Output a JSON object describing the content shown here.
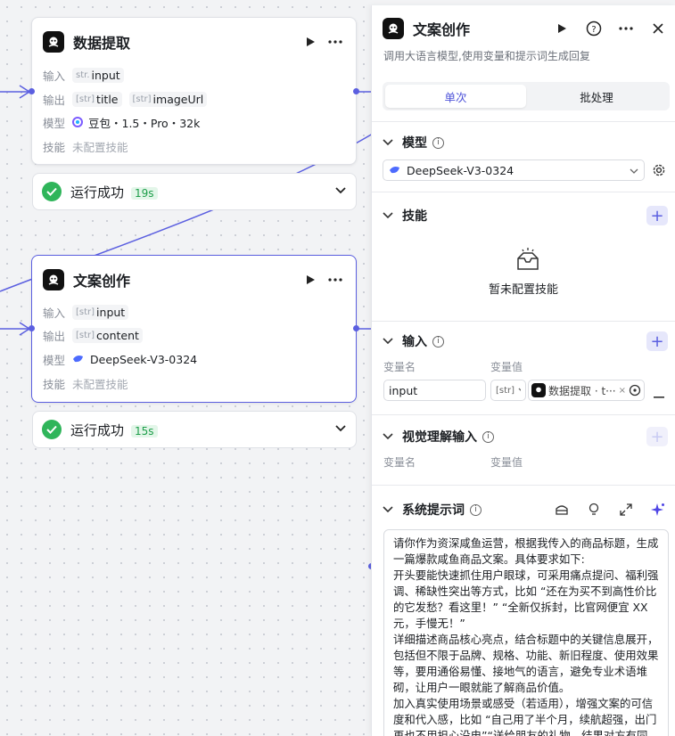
{
  "canvas": {
    "node1": {
      "title": "数据提取",
      "input_label": "输入",
      "input_type": "str.",
      "input_value": "input",
      "output_label": "输出",
      "outputs": [
        {
          "type": "[str]",
          "name": "title"
        },
        {
          "type": "[str]",
          "name": "imageUrl"
        }
      ],
      "model_label": "模型",
      "model_value": "豆包・1.5・Pro・32k",
      "skill_label": "技能",
      "skill_value": "未配置技能"
    },
    "status1": {
      "text": "运行成功",
      "duration": "19s"
    },
    "node2": {
      "title": "文案创作",
      "input_label": "输入",
      "input_type": "[str]",
      "input_value": "input",
      "output_label": "输出",
      "output_type": "[str]",
      "output_value": "content",
      "model_label": "模型",
      "model_value": "DeepSeek-V3-0324",
      "skill_label": "技能",
      "skill_value": "未配置技能"
    },
    "status2": {
      "text": "运行成功",
      "duration": "15s"
    }
  },
  "panel": {
    "title": "文案创作",
    "description": "调用大语言模型,使用变量和提示词生成回复",
    "tabs": [
      "单次",
      "批处理"
    ],
    "model_section": "模型",
    "model_value": "DeepSeek-V3-0324",
    "skill_section": "技能",
    "skill_empty": "暂未配置技能",
    "input_section": "输入",
    "var_name_label": "变量名",
    "var_value_label": "变量值",
    "var_name": "input",
    "var_type": "[str]",
    "var_ref": "数据提取 · t···",
    "vision_section": "视觉理解输入",
    "vision_var_name_label": "变量名",
    "vision_var_value_label": "变量值",
    "prompt_section": "系统提示词",
    "prompt_lines": [
      "请你作为资深咸鱼运营，根据我传入的商品标题，生成一篇爆款咸鱼商品文案。具体要求如下:",
      "开头要能快速抓住用户眼球，可采用痛点提问、福利强调、稀缺性突出等方式，比如 “还在为买不到高性价比的它发愁？看这里！” “全新仅拆封，比官网便宜 XX 元，手慢无！”",
      "详细描述商品核心亮点，结合标题中的关键信息展开，包括但不限于品牌、规格、功能、新旧程度、使用效果等，要用通俗易懂、接地气的语言，避免专业术语堆砌，让用户一眼就能了解商品价值。",
      "加入真实使用场景或感受（若适用），增强文案的可信度和代入感，比如 “自己用了半个月，续航超强，出门再也不用担心没电”“送给朋友的礼物，结果对方有同"
    ]
  },
  "colors": {
    "accent": "#5b5fe0",
    "success": "#2fb55a"
  }
}
